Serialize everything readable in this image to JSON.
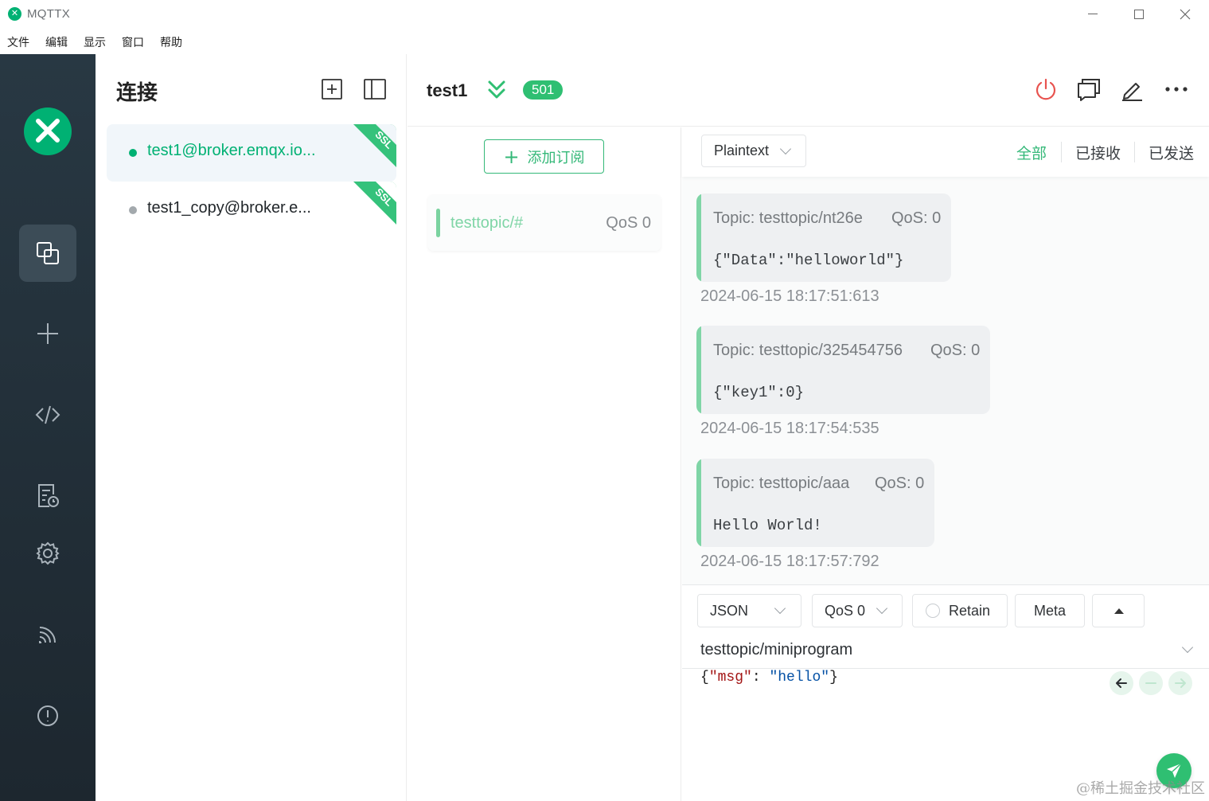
{
  "window": {
    "app_title": "MQTTX",
    "logo_glyph": "✕"
  },
  "menu": [
    "文件",
    "编辑",
    "显示",
    "窗口",
    "帮助"
  ],
  "nav": {
    "items": [
      "connections",
      "new-connection",
      "script",
      "log",
      "settings",
      "subscription-feed",
      "about"
    ],
    "active": "connections",
    "brand_color": "#00b173"
  },
  "connections": {
    "title": "连接",
    "items": [
      {
        "name": "test1@broker.emqx.io...",
        "ssl": "SSL",
        "active": true
      },
      {
        "name": "test1_copy@broker.e...",
        "ssl": "SSL",
        "active": false
      }
    ]
  },
  "header": {
    "name": "test1",
    "badge": "501"
  },
  "subscriptions": {
    "add_label": "添加订阅",
    "items": [
      {
        "topic": "testtopic/#",
        "qos": "QoS 0"
      }
    ]
  },
  "messages": {
    "payload_type": "Plaintext",
    "filters": [
      "全部",
      "已接收",
      "已发送"
    ],
    "active_filter": "全部",
    "items": [
      {
        "topic": "Topic: testtopic/nt26e",
        "qos": "QoS: 0",
        "payload": "{\"Data\":\"helloworld\"}",
        "time": "2024-06-15 18:17:51:613"
      },
      {
        "topic": "Topic: testtopic/325454756",
        "qos": "QoS: 0",
        "payload": "{\"key1\":0}",
        "time": "2024-06-15 18:17:54:535"
      },
      {
        "topic": "Topic: testtopic/aaa",
        "qos": "QoS: 0",
        "payload": "Hello World!",
        "time": "2024-06-15 18:17:57:792"
      }
    ]
  },
  "publish": {
    "format": "JSON",
    "qos": "QoS 0",
    "retain_label": "Retain",
    "meta_label": "Meta",
    "topic": "testtopic/miniprogram",
    "payload_key": "\"msg\"",
    "payload_value": "\"hello\""
  },
  "watermark": "@稀土掘金技术社区",
  "colors": {
    "accent": "#34b878",
    "badge": "#2fbf72",
    "nav_bg": "#283843",
    "disconnect": "#e8534f"
  }
}
